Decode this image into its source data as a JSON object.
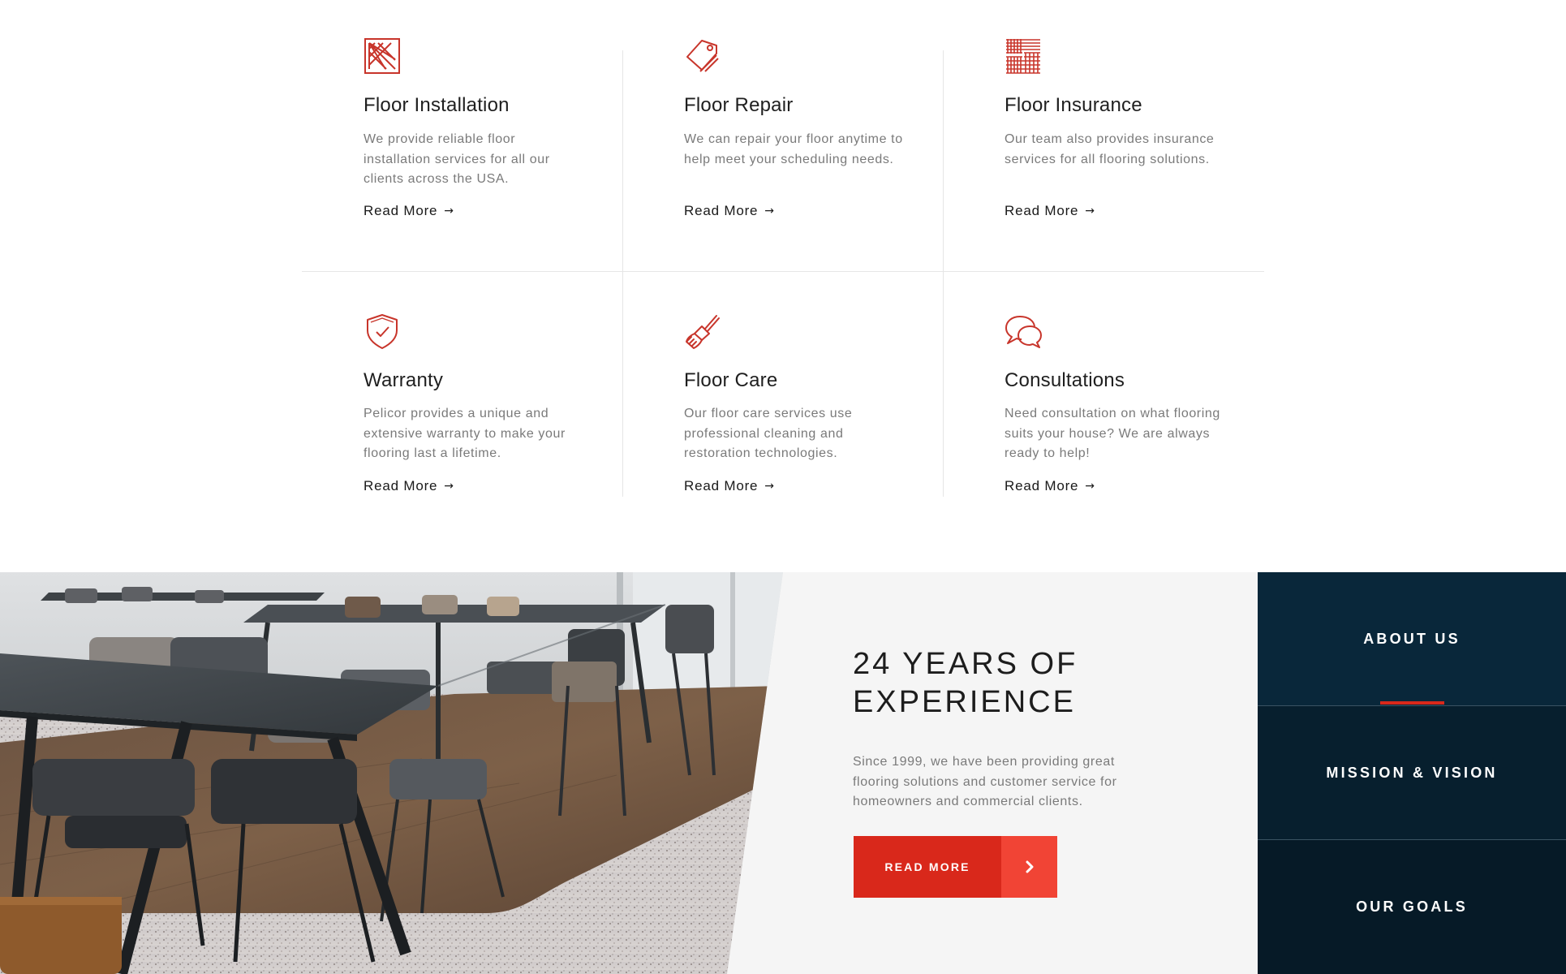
{
  "services": [
    {
      "title": "Floor Installation",
      "desc": "We provide reliable floor installation services for all our clients across the USA.",
      "more": "Read More",
      "icon": "floor-installation-icon"
    },
    {
      "title": "Floor Repair",
      "desc": "We can repair your floor anytime to help meet your scheduling needs.",
      "more": "Read More",
      "icon": "floor-repair-icon"
    },
    {
      "title": "Floor Insurance",
      "desc": "Our team also provides insurance services for all flooring solutions.",
      "more": "Read More",
      "icon": "floor-insurance-icon"
    },
    {
      "title": "Warranty",
      "desc": "Pelicor provides a unique and extensive warranty to make your flooring last a lifetime.",
      "more": "Read More",
      "icon": "shield-check-icon"
    },
    {
      "title": "Floor Care",
      "desc": "Our floor care services use professional cleaning and restoration technologies.",
      "more": "Read More",
      "icon": "brush-icon"
    },
    {
      "title": "Consultations",
      "desc": "Need consultation on what flooring suits your house? We are always ready to help!",
      "more": "Read More",
      "icon": "chat-bubbles-icon"
    }
  ],
  "experience": {
    "heading_line1": "24 YEARS OF",
    "heading_line2": "EXPERIENCE",
    "text": "Since 1999, we have been providing great flooring solutions and customer service for homeowners and commercial clients.",
    "button": "READ MORE"
  },
  "tabs": [
    "ABOUT US",
    "MISSION & VISION",
    "OUR GOALS"
  ],
  "colors": {
    "accent": "#d9281b",
    "accent_light": "#f14435",
    "navy": "#09273a",
    "icon_red": "#c8352b"
  }
}
